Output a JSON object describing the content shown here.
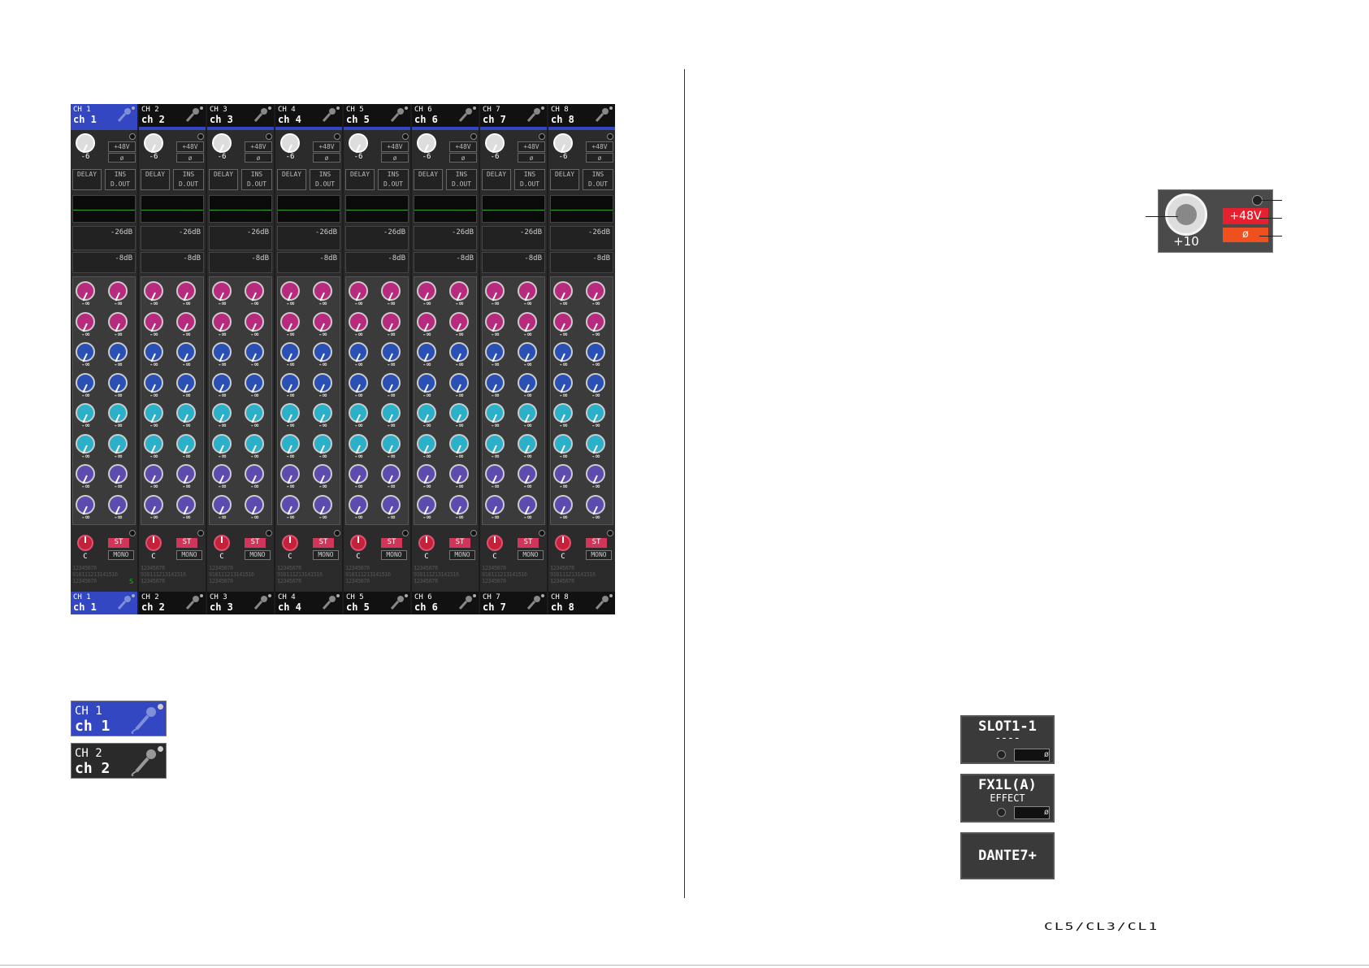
{
  "overview": {
    "channels": [
      {
        "id": "CH 1",
        "name": "ch 1",
        "selected": true
      },
      {
        "id": "CH 2",
        "name": "ch 2",
        "selected": false
      },
      {
        "id": "CH 3",
        "name": "ch 3",
        "selected": false
      },
      {
        "id": "CH 4",
        "name": "ch 4",
        "selected": false
      },
      {
        "id": "CH 5",
        "name": "ch 5",
        "selected": false
      },
      {
        "id": "CH 6",
        "name": "ch 6",
        "selected": false
      },
      {
        "id": "CH 7",
        "name": "ch 7",
        "selected": false
      },
      {
        "id": "CH 8",
        "name": "ch 8",
        "selected": false
      }
    ],
    "gain_value": "-6",
    "phantom_label": "+48V",
    "phase_label": "ø",
    "delay_label": "DELAY",
    "ins_label": "INS",
    "dout_label": "D.OUT",
    "gate_threshold": "-26dB",
    "comp_threshold": "-8dB",
    "send_value": "-∞",
    "pan_value": "C",
    "st_label": "ST",
    "mono_label": "MONO",
    "bus_rows": [
      "12345678",
      "910111213141516",
      "12345678"
    ],
    "solo_label": "S",
    "send_colors": [
      "#b82a7e",
      "#b82a7e",
      "#2b50b5",
      "#2b50b5",
      "#2ab0c8",
      "#2ab0c8",
      "#5d4bb0",
      "#5d4bb0"
    ]
  },
  "examples": {
    "selected": {
      "id": "CH 1",
      "name": "ch 1"
    },
    "unselected": {
      "id": "CH 2",
      "name": "ch 2"
    }
  },
  "gain_detail": {
    "value": "+10",
    "phantom_label": "+48V",
    "phase_label": "ø"
  },
  "patch_buttons": [
    {
      "line1": "SLOT1-1",
      "line2": "----",
      "phase": "ø"
    },
    {
      "line1": "FX1L(A)",
      "line2": "EFFECT",
      "phase": "ø"
    },
    {
      "line1": "DANTE7+"
    }
  ],
  "footer_logo": "CL5/CL3/CL1"
}
